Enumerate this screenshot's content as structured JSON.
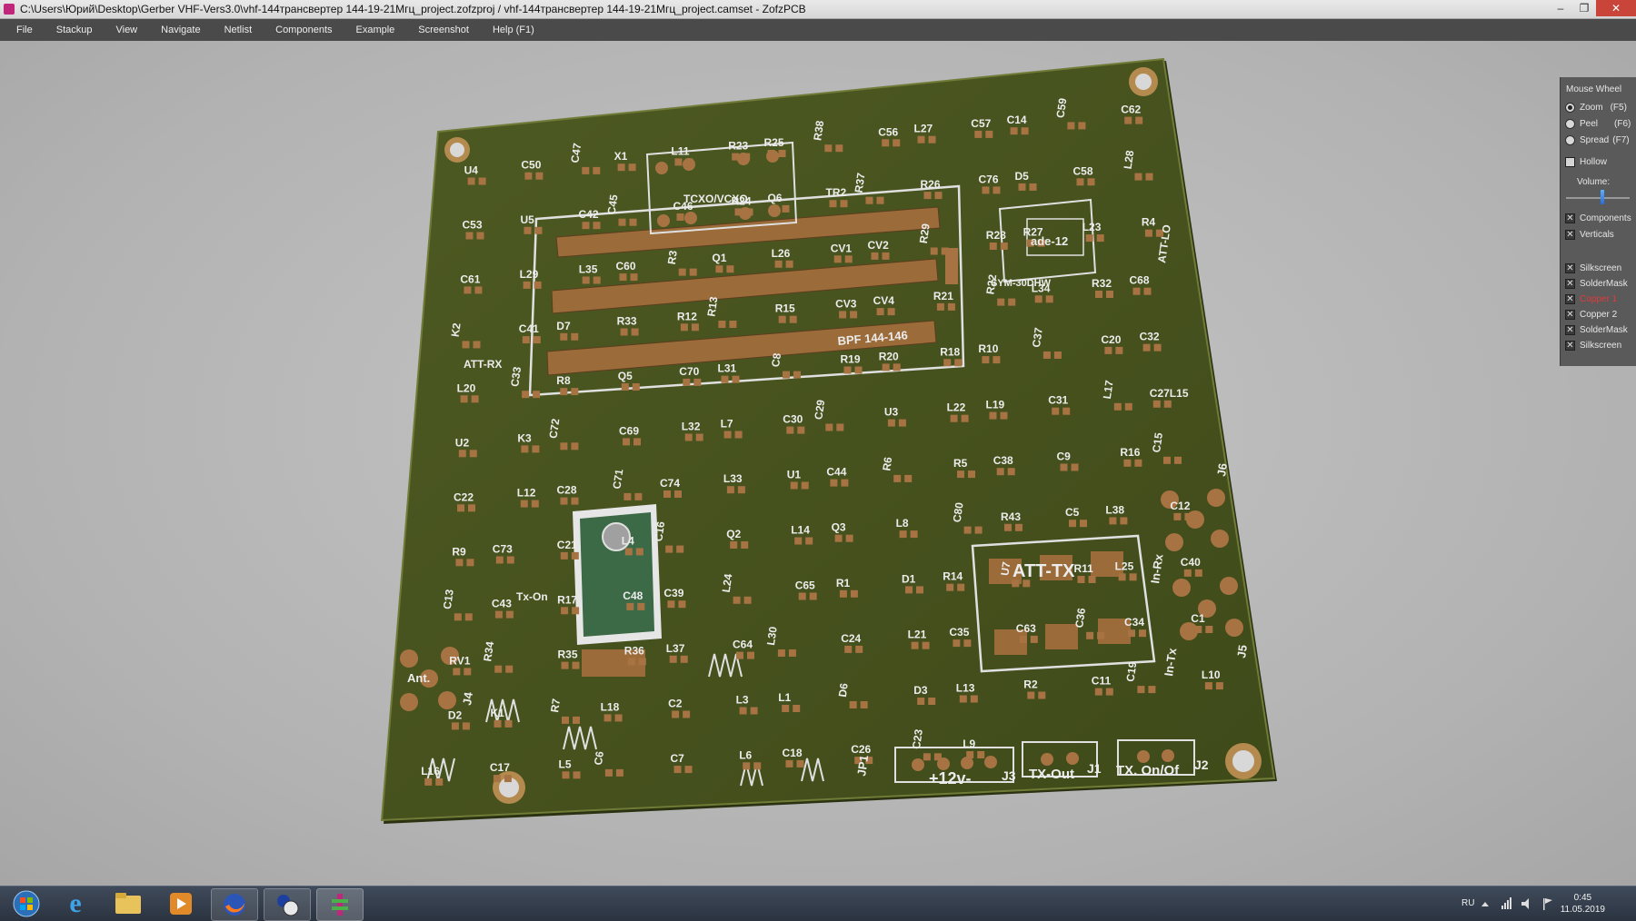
{
  "window": {
    "title": "C:\\Users\\Юрий\\Desktop\\Gerber VHF-Vers3.0\\vhf-144трансвертер 144-19-21Мгц_project.zofzproj / vhf-144трансвертер 144-19-21Мгц_project.camset - ZofzPCB",
    "minimize": "–",
    "restore": "❐",
    "close": "✕"
  },
  "menu": [
    {
      "label": "File"
    },
    {
      "label": "Stackup"
    },
    {
      "label": "View"
    },
    {
      "label": "Navigate"
    },
    {
      "label": "Netlist"
    },
    {
      "label": "Components"
    },
    {
      "label": "Example"
    },
    {
      "label": "Screenshot"
    },
    {
      "label": "Help (F1)"
    }
  ],
  "panel": {
    "title": "Mouse Wheel",
    "modes": [
      {
        "label": "Zoom",
        "key": "(F5)",
        "selected": true
      },
      {
        "label": "Peel",
        "key": "(F6)",
        "selected": false
      },
      {
        "label": "Spread",
        "key": "(F7)",
        "selected": false
      }
    ],
    "hollow": "Hollow",
    "volume": "Volume:",
    "volume_level": 0.62,
    "view_toggles": [
      "Components",
      "Verticals"
    ],
    "layers": [
      {
        "label": "Silkscreen",
        "color": "#e6e6e6"
      },
      {
        "label": "SolderMask",
        "color": "#e6e6e6"
      },
      {
        "label": "Copper 1",
        "color": "#e23a3a"
      },
      {
        "label": "Copper 2",
        "color": "#e6e6e6"
      },
      {
        "label": "SolderMask",
        "color": "#e6e6e6"
      },
      {
        "label": "Silkscreen",
        "color": "#e6e6e6"
      }
    ]
  },
  "board": {
    "labels": {
      "tcxo": "TCXO/VCXO",
      "bpf": "BPF 144-146",
      "ade": "ade-12",
      "sym": "SYM-30DHW",
      "att_lo": "ATT-LO",
      "att_rx": "ATT-RX",
      "att_tx": "ATT-TX",
      "in_rx": "In-Rx",
      "in_tx": "In-Tx",
      "ant": "Ant.",
      "tx_on": "Tx-On",
      "power": "+12v-",
      "tx_out": "TX-Out",
      "tx_onoff": "TX. On/Of",
      "j1": "J1",
      "j2": "J2",
      "j3": "J3",
      "j4": "J4",
      "j5": "J5",
      "j6": "J6",
      "jp1": "JP1"
    },
    "designators": [
      "U4",
      "C50",
      "C47",
      "X1",
      "L11",
      "R23",
      "R25",
      "R38",
      "C56",
      "L27",
      "C57",
      "C14",
      "C59",
      "C62",
      "C53",
      "U5",
      "C42",
      "C45",
      "C46",
      "R24",
      "Q6",
      "TR2",
      "R37",
      "R26",
      "C76",
      "D5",
      "C58",
      "L28",
      "C61",
      "L29",
      "L35",
      "C60",
      "R3",
      "Q1",
      "L26",
      "CV1",
      "CV2",
      "R29",
      "R28",
      "R27",
      "L23",
      "R4",
      "K2",
      "C41",
      "D7",
      "R33",
      "R12",
      "R13",
      "R15",
      "CV3",
      "CV4",
      "R21",
      "R22",
      "L34",
      "R32",
      "C68",
      "L20",
      "C33",
      "R8",
      "Q5",
      "C70",
      "L31",
      "C8",
      "R19",
      "R20",
      "R18",
      "R10",
      "C37",
      "C20",
      "C32",
      "U2",
      "K3",
      "C72",
      "C69",
      "L32",
      "L7",
      "C30",
      "C29",
      "U3",
      "L22",
      "L19",
      "C31",
      "L17",
      "C27L15",
      "C22",
      "L12",
      "C28",
      "C71",
      "C74",
      "L33",
      "U1",
      "C44",
      "R6",
      "R5",
      "C38",
      "C9",
      "R16",
      "C15",
      "R9",
      "C73",
      "C21",
      "L4",
      "C16",
      "Q2",
      "L14",
      "Q3",
      "L8",
      "C80",
      "R43",
      "C5",
      "L38",
      "C12",
      "C13",
      "C43",
      "R17",
      "C48",
      "C39",
      "L24",
      "C65",
      "R1",
      "D1",
      "R14",
      "U7",
      "R11",
      "L25",
      "C40",
      "RV1",
      "R34",
      "R35",
      "R36",
      "L37",
      "C64",
      "L30",
      "C24",
      "L21",
      "C35",
      "C63",
      "C36",
      "C34",
      "C1",
      "D2",
      "K1",
      "R7",
      "L18",
      "C2",
      "L3",
      "L1",
      "D6",
      "D3",
      "L13",
      "R2",
      "C11",
      "C19",
      "L10",
      "L16",
      "C17",
      "L5",
      "C6",
      "C7",
      "L6",
      "C18",
      "C26",
      "C23",
      "L9"
    ]
  },
  "taskbar": {
    "lang": "RU",
    "time": "0:45",
    "date": "11.05.2019"
  }
}
